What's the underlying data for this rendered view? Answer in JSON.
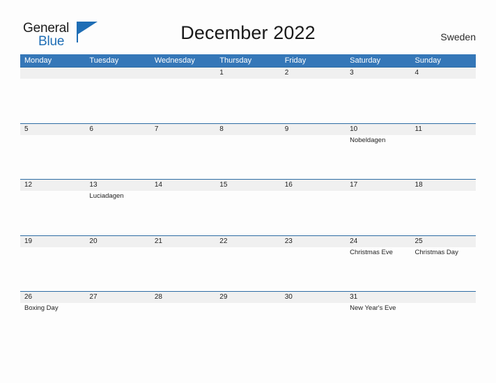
{
  "brand": {
    "name_part1": "General",
    "name_part2": "Blue",
    "flag_icon": "blue-triangle-flag-icon",
    "color_primary": "#1f6eb5",
    "color_text": "#1c1c1c"
  },
  "header": {
    "title": "December 2022",
    "country": "Sweden"
  },
  "theme": {
    "header_bar_color": "#3577b8",
    "row_rule_color": "#2e6da4",
    "date_band_color": "#f0f0f0",
    "page_background": "#fdfdfd"
  },
  "calendar": {
    "month": "December",
    "year": "2022",
    "week_start": "Monday",
    "weekdays": [
      {
        "label": "Monday"
      },
      {
        "label": "Tuesday"
      },
      {
        "label": "Wednesday"
      },
      {
        "label": "Thursday"
      },
      {
        "label": "Friday"
      },
      {
        "label": "Saturday"
      },
      {
        "label": "Sunday"
      }
    ],
    "weeks": [
      {
        "days": [
          {
            "date": "",
            "event": ""
          },
          {
            "date": "",
            "event": ""
          },
          {
            "date": "",
            "event": ""
          },
          {
            "date": "1",
            "event": ""
          },
          {
            "date": "2",
            "event": ""
          },
          {
            "date": "3",
            "event": ""
          },
          {
            "date": "4",
            "event": ""
          }
        ]
      },
      {
        "days": [
          {
            "date": "5",
            "event": ""
          },
          {
            "date": "6",
            "event": ""
          },
          {
            "date": "7",
            "event": ""
          },
          {
            "date": "8",
            "event": ""
          },
          {
            "date": "9",
            "event": ""
          },
          {
            "date": "10",
            "event": "Nobeldagen"
          },
          {
            "date": "11",
            "event": ""
          }
        ]
      },
      {
        "days": [
          {
            "date": "12",
            "event": ""
          },
          {
            "date": "13",
            "event": "Luciadagen"
          },
          {
            "date": "14",
            "event": ""
          },
          {
            "date": "15",
            "event": ""
          },
          {
            "date": "16",
            "event": ""
          },
          {
            "date": "17",
            "event": ""
          },
          {
            "date": "18",
            "event": ""
          }
        ]
      },
      {
        "days": [
          {
            "date": "19",
            "event": ""
          },
          {
            "date": "20",
            "event": ""
          },
          {
            "date": "21",
            "event": ""
          },
          {
            "date": "22",
            "event": ""
          },
          {
            "date": "23",
            "event": ""
          },
          {
            "date": "24",
            "event": "Christmas Eve"
          },
          {
            "date": "25",
            "event": "Christmas Day"
          }
        ]
      },
      {
        "days": [
          {
            "date": "26",
            "event": "Boxing Day"
          },
          {
            "date": "27",
            "event": ""
          },
          {
            "date": "28",
            "event": ""
          },
          {
            "date": "29",
            "event": ""
          },
          {
            "date": "30",
            "event": ""
          },
          {
            "date": "31",
            "event": "New Year's Eve"
          },
          {
            "date": "",
            "event": ""
          }
        ]
      }
    ]
  }
}
